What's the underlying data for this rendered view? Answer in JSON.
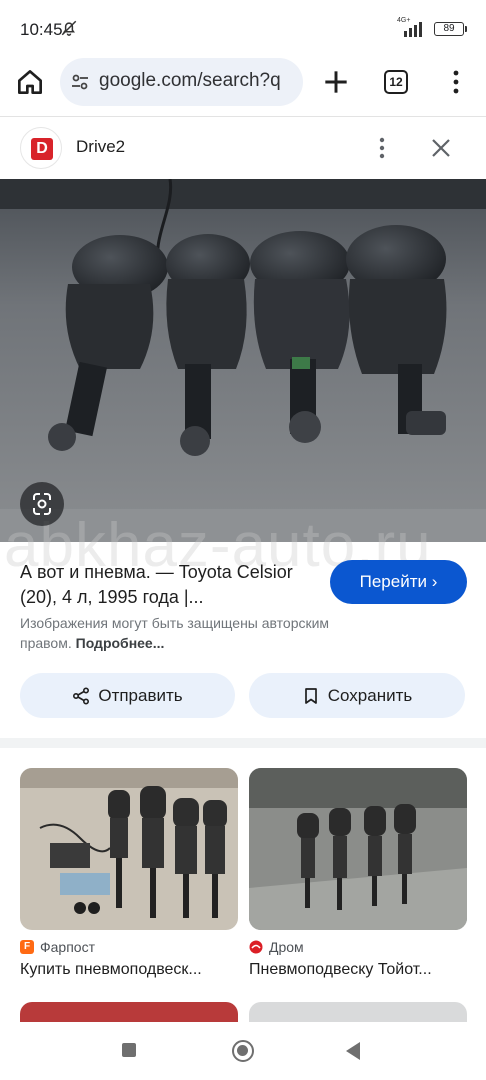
{
  "status_bar": {
    "time": "10:45",
    "network": "4G+",
    "battery": "89"
  },
  "browser": {
    "url": "google.com/search?q",
    "tab_count": "12"
  },
  "source": {
    "logo_letter": "D",
    "name": "Drive2"
  },
  "watermark": "abkhaz-auto.ru",
  "result": {
    "title": "А вот и пневма. — Toyota Celsior (20), 4 л, 1995 года |...",
    "goto_label": "Перейти",
    "rights_text": "Изображения могут быть защищены авторским правом.",
    "rights_more": "Подробнее...",
    "share_label": "Отправить",
    "save_label": "Сохранить"
  },
  "related": [
    {
      "source": "Фарпост",
      "fav": "F",
      "title": "Купить пневмоподвеск..."
    },
    {
      "source": "Дром",
      "title": "Пневмоподвеску Тойот..."
    }
  ],
  "colors": {
    "accent": "#0b57d0",
    "chip_bg": "#eaf1fb",
    "drive2_red": "#d8232a",
    "farpost_orange": "#ff6a13",
    "drom_red": "#db1f26"
  }
}
